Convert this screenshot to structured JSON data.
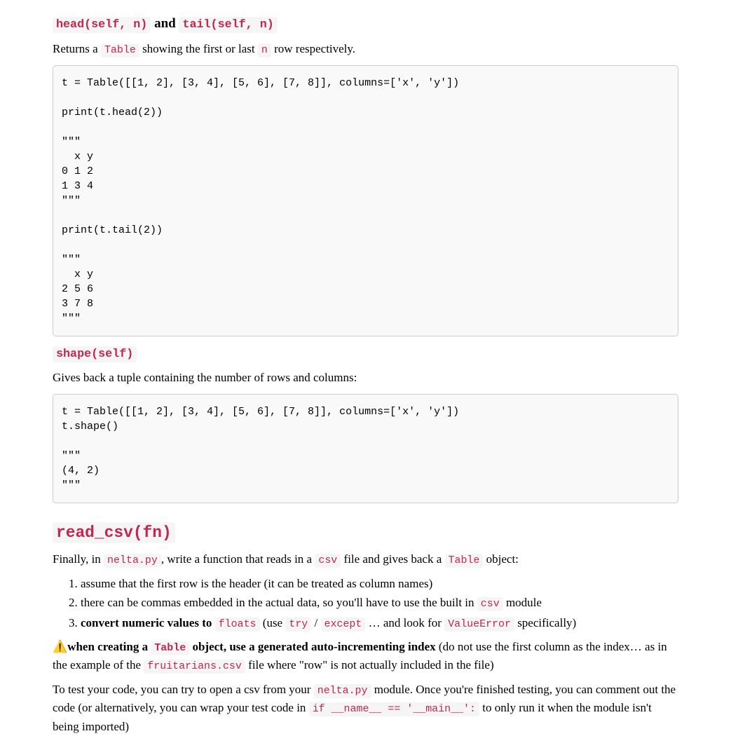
{
  "section1": {
    "heading_code1": "head(self, n)",
    "heading_and": " and ",
    "heading_code2": "tail(self, n)",
    "para_pre": "Returns a ",
    "para_code1": "Table",
    "para_mid": " showing the first or last ",
    "para_code2": "n",
    "para_post": " row respectively.",
    "code": "t = Table([[1, 2], [3, 4], [5, 6], [7, 8]], columns=['x', 'y'])\n\nprint(t.head(2))\n\n\"\"\"\n  x y\n0 1 2\n1 3 4\n\"\"\"\n\nprint(t.tail(2))\n\n\"\"\"\n  x y\n2 5 6\n3 7 8\n\"\"\""
  },
  "section2": {
    "heading_code": "shape(self)",
    "para": "Gives back a tuple containing the number of rows and columns:",
    "code": "t = Table([[1, 2], [3, 4], [5, 6], [7, 8]], columns=['x', 'y'])\nt.shape()\n\n\"\"\"\n(4, 2)\n\"\"\""
  },
  "section3": {
    "heading_code": "read_csv(fn)",
    "p1_pre": "Finally, in ",
    "p1_code1": "nelta.py",
    "p1_mid1": ", write a function that reads in a ",
    "p1_code2": "csv",
    "p1_mid2": " file and gives back a ",
    "p1_code3": "Table",
    "p1_post": " object:",
    "li1": "assume that the first row is the header (it can be treated as column names)",
    "li2_pre": "there can be commas embedded in the actual data, so you'll have to use the built in ",
    "li2_code": "csv",
    "li2_post": " module",
    "li3_bold": "convert numeric values to ",
    "li3_code1": "floats",
    "li3_mid1": " (use ",
    "li3_code2": "try",
    "li3_slash": " / ",
    "li3_code3": "except",
    "li3_mid2": " … and look for ",
    "li3_code4": "ValueError",
    "li3_post": " specifically)",
    "warn_emoji": "⚠️",
    "warn_bold1": "when creating a ",
    "warn_code1": "Table",
    "warn_bold2": " object, use a generated auto-incrementing index",
    "warn_mid": " (do not use the first column as the index… as in the example of the ",
    "warn_code2": "fruitarians.csv",
    "warn_post": " file where \"row\" is not actually included in the file)",
    "p3_pre": "To test your code, you can try to open a csv from your ",
    "p3_code1": "nelta.py",
    "p3_mid1": " module. Once you're finished testing, you can comment out the code (or alternatively, you can wrap your test code in ",
    "p3_code2": "if __name__ == '__main__':",
    "p3_post": " to only run it when the module isn't being imported)"
  }
}
